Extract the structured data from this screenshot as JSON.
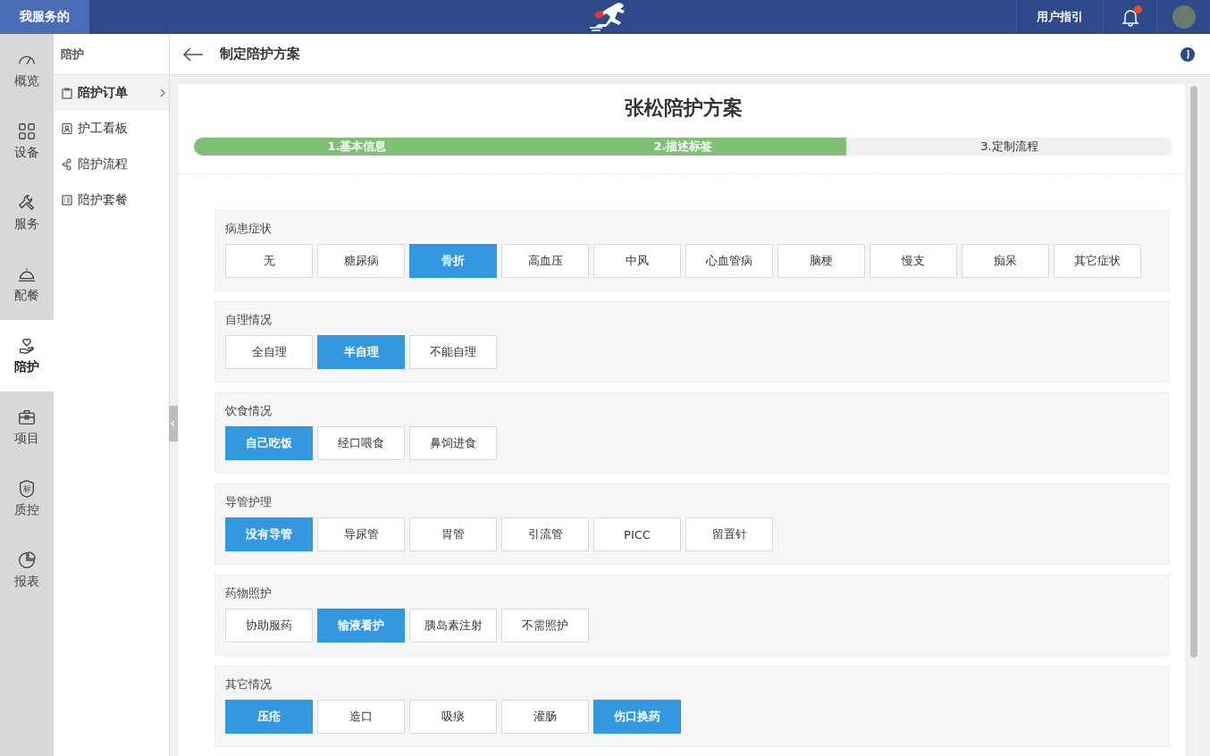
{
  "topbar": {
    "brand": "我服务的",
    "guide": "用户指引",
    "notification_unread": true
  },
  "rail": [
    {
      "label": "概览",
      "selected": false
    },
    {
      "label": "设备",
      "selected": false
    },
    {
      "label": "服务",
      "selected": false
    },
    {
      "label": "配餐",
      "selected": false
    },
    {
      "label": "陪护",
      "selected": true
    },
    {
      "label": "项目",
      "selected": false
    },
    {
      "label": "质控",
      "icon_text": "标",
      "selected": false
    },
    {
      "label": "报表",
      "selected": false
    }
  ],
  "submenu": {
    "title": "陪护",
    "items": [
      {
        "label": "陪护订单",
        "selected": true
      },
      {
        "label": "护工看板",
        "selected": false
      },
      {
        "label": "陪护流程",
        "selected": false
      },
      {
        "label": "陪护套餐",
        "selected": false
      }
    ]
  },
  "page": {
    "title": "制定陪护方案"
  },
  "plan": {
    "title": "张松陪护方案",
    "steps": [
      {
        "label": "1.基本信息",
        "done": true
      },
      {
        "label": "2.描述标签",
        "done": true
      },
      {
        "label": "3.定制流程",
        "done": false
      }
    ],
    "groups": [
      {
        "label": "病患症状",
        "options": [
          {
            "label": "无",
            "selected": false
          },
          {
            "label": "糖尿病",
            "selected": false
          },
          {
            "label": "骨折",
            "selected": true
          },
          {
            "label": "高血压",
            "selected": false
          },
          {
            "label": "中风",
            "selected": false
          },
          {
            "label": "心血管病",
            "selected": false
          },
          {
            "label": "脑梗",
            "selected": false
          },
          {
            "label": "慢支",
            "selected": false
          },
          {
            "label": "痴呆",
            "selected": false
          },
          {
            "label": "其它症状",
            "selected": false
          }
        ]
      },
      {
        "label": "自理情况",
        "options": [
          {
            "label": "全自理",
            "selected": false
          },
          {
            "label": "半自理",
            "selected": true
          },
          {
            "label": "不能自理",
            "selected": false
          }
        ]
      },
      {
        "label": "饮食情况",
        "options": [
          {
            "label": "自己吃饭",
            "selected": true
          },
          {
            "label": "经口喂食",
            "selected": false
          },
          {
            "label": "鼻饲进食",
            "selected": false
          }
        ]
      },
      {
        "label": "导管护理",
        "options": [
          {
            "label": "没有导管",
            "selected": true
          },
          {
            "label": "导尿管",
            "selected": false
          },
          {
            "label": "胃管",
            "selected": false
          },
          {
            "label": "引流管",
            "selected": false
          },
          {
            "label": "PICC",
            "selected": false
          },
          {
            "label": "留置针",
            "selected": false
          }
        ]
      },
      {
        "label": "药物照护",
        "options": [
          {
            "label": "协助服药",
            "selected": false
          },
          {
            "label": "输液看护",
            "selected": true
          },
          {
            "label": "胰岛素注射",
            "selected": false
          },
          {
            "label": "不需照护",
            "selected": false
          }
        ]
      },
      {
        "label": "其它情况",
        "options": [
          {
            "label": "压疮",
            "selected": true
          },
          {
            "label": "造口",
            "selected": false
          },
          {
            "label": "吸痰",
            "selected": false
          },
          {
            "label": "灌肠",
            "selected": false
          },
          {
            "label": "伤口换药",
            "selected": true
          }
        ]
      }
    ]
  }
}
